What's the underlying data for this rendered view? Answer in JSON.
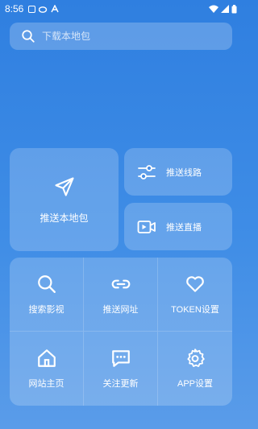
{
  "status_bar": {
    "time": "8:56"
  },
  "search": {
    "placeholder": "下载本地包"
  },
  "actions": {
    "push_local": {
      "label": "推送本地包"
    },
    "push_route": {
      "label": "推送线路"
    },
    "push_live": {
      "label": "推送直播"
    }
  },
  "grid": [
    {
      "label": "搜索影视",
      "icon": "search-icon"
    },
    {
      "label": "推送网址",
      "icon": "link-icon"
    },
    {
      "label": "TOKEN设置",
      "icon": "heart-icon"
    },
    {
      "label": "网站主页",
      "icon": "home-icon"
    },
    {
      "label": "关注更新",
      "icon": "chat-icon"
    },
    {
      "label": "APP设置",
      "icon": "gear-icon"
    }
  ],
  "colors": {
    "background": "#2f7fe0",
    "card": "rgba(255,255,255,0.2)",
    "text": "#ffffff"
  }
}
